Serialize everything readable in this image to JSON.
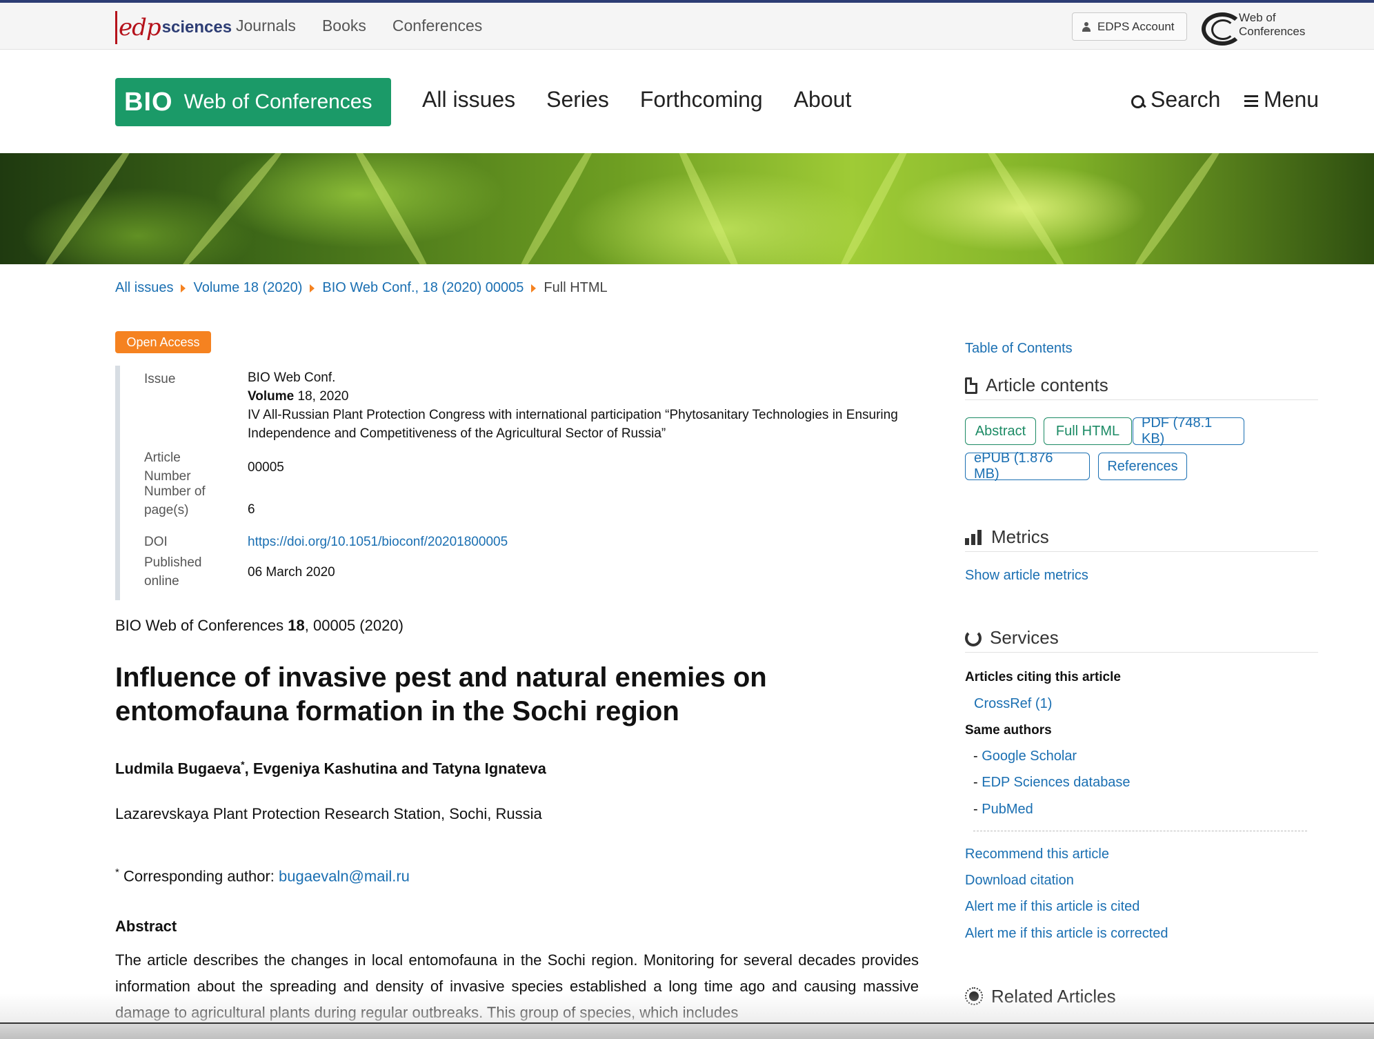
{
  "topbar": {
    "logo": {
      "edp": "edp",
      "sciences": "sciences"
    },
    "nav": [
      "Journals",
      "Books",
      "Conferences"
    ],
    "account_label": "EDPS Account",
    "woc_logo": {
      "line1": "Web of",
      "line2": "Conferences"
    }
  },
  "header": {
    "logo": {
      "bio": "BIO",
      "rest": "Web of Conferences"
    },
    "nav": [
      "All issues",
      "Series",
      "Forthcoming",
      "About"
    ],
    "search_label": "Search",
    "menu_label": "Menu"
  },
  "breadcrumb": [
    {
      "label": "All issues"
    },
    {
      "label": "Volume 18 (2020)"
    },
    {
      "label": "BIO Web Conf., 18 (2020) 00005"
    }
  ],
  "breadcrumb_current": "Full HTML",
  "article": {
    "open_access": "Open Access",
    "meta": {
      "issue_label": "Issue",
      "issue_journal": "BIO Web Conf.",
      "issue_volume_label": "Volume",
      "issue_volume_value": "18, 2020",
      "issue_title": "IV All-Russian Plant Protection Congress with international participation “Phytosanitary Technologies in Ensuring Independence and Competitiveness of the Agricultural Sector of Russia”",
      "article_number_label_1": "Article",
      "article_number_label_2": "Number",
      "article_number": "00005",
      "pages_label_1": "Number of",
      "pages_label_2": "page(s)",
      "pages": "6",
      "doi_label": "DOI",
      "doi": "https://doi.org/10.1051/bioconf/20201800005",
      "published_label_1": "Published",
      "published_label_2": "online",
      "published": "06 March 2020"
    },
    "citation_journal": "BIO Web of Conferences",
    "citation_volume": "18",
    "citation_rest": ", 00005 (2020)",
    "title": "Influence of invasive pest and natural enemies on entomofauna formation in the Sochi region",
    "author_1": "Ludmila Bugaeva",
    "author_mark": "*",
    "authors_rest": ", Evgeniya Kashutina and Tatyna Ignateva",
    "affiliation": "Lazarevskaya Plant Protection Research Station, Sochi, Russia",
    "corr_mark": "*",
    "corr_label": "Corresponding author:",
    "corr_email": "bugaevaln@mail.ru",
    "abstract_heading": "Abstract",
    "abstract_text": "The article describes the changes in local entomofauna in the Sochi region. Monitoring for several decades provides information about the spreading and density of invasive species established a long time ago and causing massive damage to agricultural plants during regular outbreaks. This group of species, which includes"
  },
  "sidebar": {
    "toc": "Table of Contents",
    "article_contents_heading": "Article contents",
    "contents_buttons": [
      "Abstract",
      "Full HTML",
      "PDF (748.1 KB)",
      "ePUB (1.876 MB)",
      "References"
    ],
    "metrics_heading": "Metrics",
    "show_metrics": "Show article metrics",
    "services_heading": "Services",
    "citing_heading": "Articles citing this article",
    "crossref": "CrossRef (1)",
    "same_authors_heading": "Same authors",
    "same_authors_links": [
      "Google Scholar",
      "EDP Sciences database",
      "PubMed"
    ],
    "dash": "-",
    "actions": [
      "Recommend this article",
      "Download citation",
      "Alert me if this article is cited",
      "Alert me if this article is corrected"
    ],
    "related_heading": "Related Articles"
  },
  "colors": {
    "link": "#1a6fb2",
    "accent_orange": "#f58220",
    "brand_green": "#1b9a68",
    "navy": "#2d3d74"
  }
}
